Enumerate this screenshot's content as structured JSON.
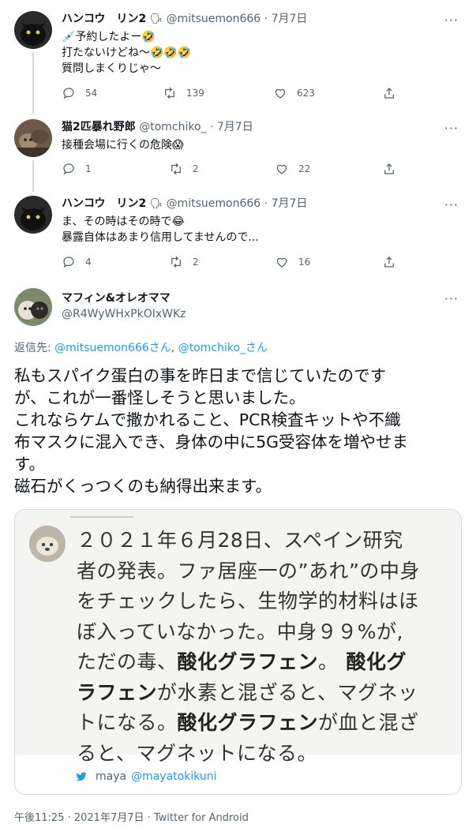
{
  "tweets": [
    {
      "name": "ハンコウ　リン2",
      "name_icon": "🗣",
      "handle": "@mitsuemon666",
      "date": "· 7月7日",
      "lines": [
        "💉予約したよー🤣",
        "打たないけどね〜🤣🤣🤣",
        "質問しまくりじゃ〜"
      ],
      "reply_count": "54",
      "retweet_count": "139",
      "like_count": "623"
    },
    {
      "name": "猫2匹暴れ野郎",
      "handle": "@tomchiko_",
      "date": "· 7月7日",
      "lines": [
        "接種会場に行くの危険😱"
      ],
      "reply_count": "1",
      "retweet_count": "2",
      "like_count": "22"
    },
    {
      "name": "ハンコウ　リン2",
      "name_icon": "🗣",
      "handle": "@mitsuemon666",
      "date": "· 7月7日",
      "lines": [
        "ま、その時はその時で😂",
        "暴露自体はあまり信用してませんので..."
      ],
      "reply_count": "4",
      "retweet_count": "2",
      "like_count": "16"
    }
  ],
  "main_tweet": {
    "name": "マフィン&オレオママ",
    "handle": "@R4WyWHxPkOIxWKz",
    "reply_to_label": "返信先: ",
    "reply_to_user1": "@mitsuemon666さん",
    "reply_to_sep": ", ",
    "reply_to_user2": "@tomchiko_さん",
    "lines": [
      "私もスパイク蛋白の事を昨日まで信じていたのです",
      "が、これが一番怪しそうと思いました。",
      "これならケムで撒かれること、PCR検査キットや不織",
      "布マスクに混入でき、身体の中に5G受容体を増やせま",
      "す。",
      "磁石がくっつくのも納得出来ます。"
    ],
    "timestamp": "午後11:25 · 2021年7月7日 · Twitter for Android"
  },
  "card": {
    "line1": "２０２１年６月28日、スペイン研究",
    "line2": "者の発表。ファ居座一の”あれ”の中身",
    "line3": "をチェックしたら、生物学的材料はほ",
    "line4": "ぼ入っていなかった。中身９９%が,",
    "line5a": "ただの毒、",
    "line5b": "酸化グラフェン",
    "line5c": "。",
    "line5d": "酸化グ",
    "line6a": "ラフェン",
    "line6b": "が水素と混ざると、マグネッ",
    "line7a": "トになる。",
    "line7b": "酸化グラフェン",
    "line7c": "が血と混ざ",
    "line8": "ると、マグネットになる。",
    "footer_name": "maya",
    "footer_handle": "@mayatokikuni"
  },
  "colors": {
    "accent": "#1d9bf0",
    "muted": "#536471",
    "text": "#0f1419",
    "border": "#cfd9de"
  }
}
